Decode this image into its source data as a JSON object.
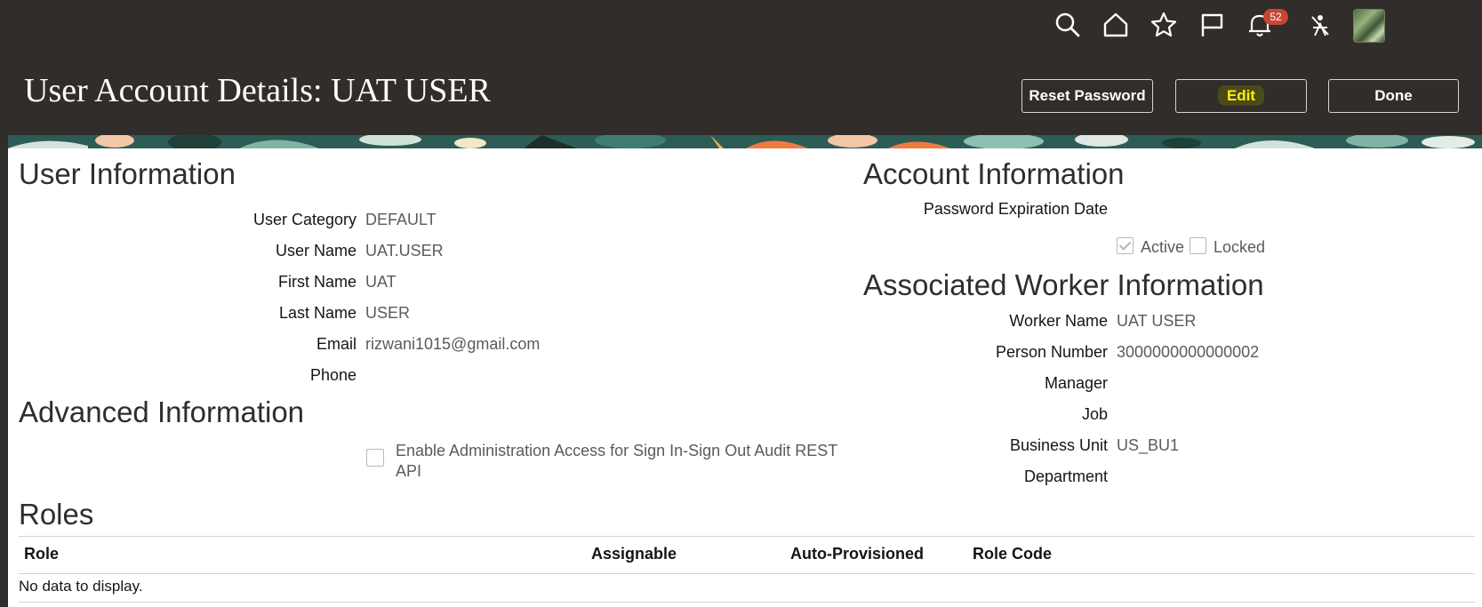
{
  "header": {
    "title": "User Account Details: UAT USER",
    "notification_count": "52",
    "buttons": {
      "reset_password": "Reset Password",
      "edit": "Edit",
      "done": "Done"
    },
    "icons": [
      "search-icon",
      "home-icon",
      "star-icon",
      "flag-icon",
      "bell-icon",
      "accessibility-off-icon",
      "avatar"
    ],
    "colors": {
      "bar": "#312d2a",
      "badge": "#c74634",
      "edit_highlight": "#f6f207"
    }
  },
  "user_information": {
    "heading": "User Information",
    "fields": [
      {
        "label": "User Category",
        "value": "DEFAULT"
      },
      {
        "label": "User Name",
        "value": "UAT.USER"
      },
      {
        "label": "First Name",
        "value": "UAT"
      },
      {
        "label": "Last Name",
        "value": "USER"
      },
      {
        "label": "Email",
        "value": "rizwani1015@gmail.com"
      },
      {
        "label": "Phone",
        "value": ""
      }
    ]
  },
  "advanced_information": {
    "heading": "Advanced Information",
    "checkbox_line1": "Enable Administration Access for Sign In-Sign Out Audit REST",
    "checkbox_line2": "API",
    "checked": false
  },
  "account_information": {
    "heading": "Account Information",
    "password_expiration_label": "Password Expiration Date",
    "active_label": "Active",
    "active_checked": true,
    "locked_label": "Locked",
    "locked_checked": false
  },
  "associated_worker": {
    "heading": "Associated Worker Information",
    "fields": [
      {
        "label": "Worker Name",
        "value": "UAT USER"
      },
      {
        "label": "Person Number",
        "value": "3000000000000002"
      },
      {
        "label": "Manager",
        "value": ""
      },
      {
        "label": "Job",
        "value": ""
      },
      {
        "label": "Business Unit",
        "value": "US_BU1"
      },
      {
        "label": "Department",
        "value": ""
      }
    ]
  },
  "roles": {
    "heading": "Roles",
    "columns": [
      "Role",
      "Assignable",
      "Auto-Provisioned",
      "Role Code"
    ],
    "empty_text": "No data to display."
  }
}
